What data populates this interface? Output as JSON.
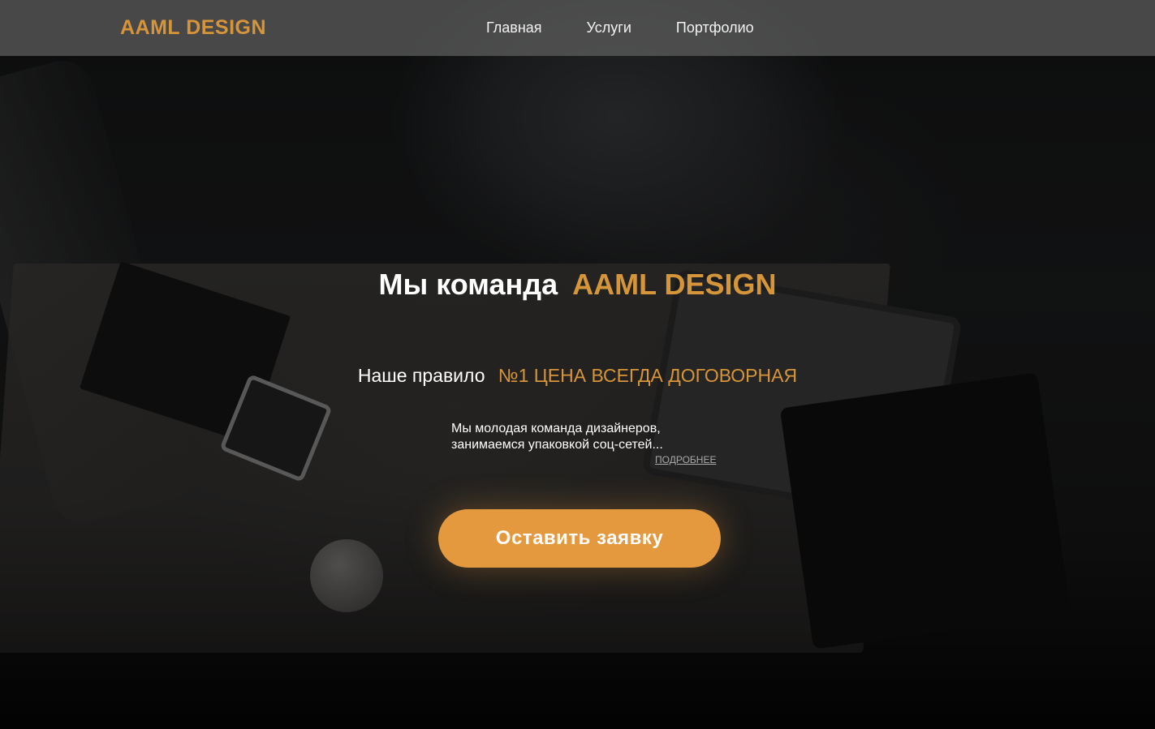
{
  "header": {
    "logo": "AAML DESIGN",
    "nav": [
      {
        "label": "Главная"
      },
      {
        "label": "Услуги"
      },
      {
        "label": "Портфолио"
      }
    ]
  },
  "hero": {
    "headline_prefix": "Мы команда",
    "headline_accent": "AAML DESIGN",
    "rule_prefix": "Наше правило",
    "rule_accent": "№1 ЦЕНА ВСЕГДА ДОГОВОРНАЯ",
    "description_line1": "Мы молодая команда дизайнеров,",
    "description_line2": "занимаемся упаковкой соц-сетей...",
    "more_link": "ПОДРОБНЕЕ",
    "cta_label": "Оставить заявку"
  },
  "colors": {
    "accent": "#d7953a",
    "button": "#e4993e",
    "header_bg": "#5f5f5f"
  }
}
